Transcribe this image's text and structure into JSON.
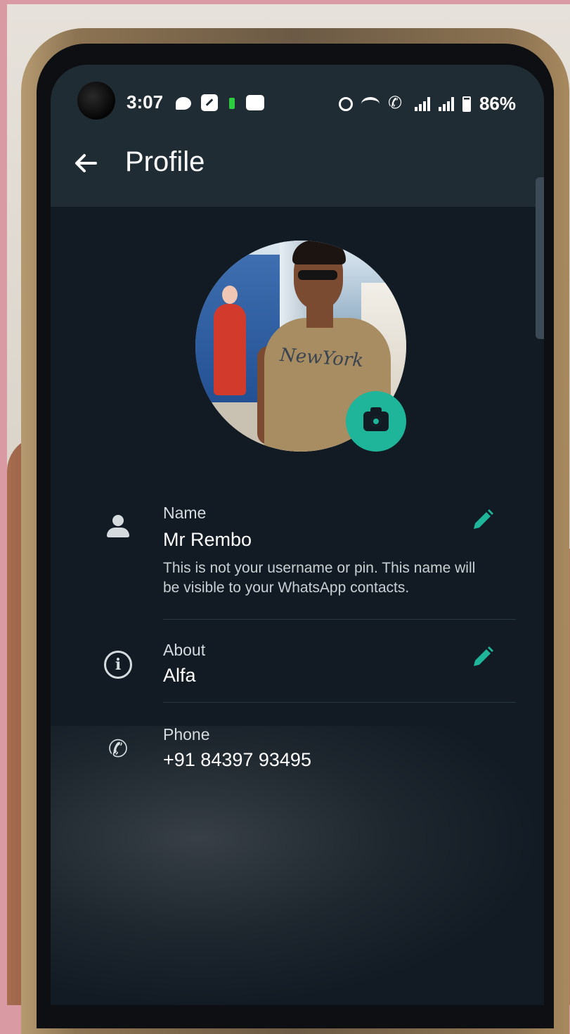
{
  "status_bar": {
    "time": "3:07",
    "battery_percent": "86%",
    "icons": [
      "chat-bubble-icon",
      "note-icon",
      "battery-mini-icon",
      "app-mini-icon",
      "alarm-icon",
      "wifi-icon",
      "call-icon",
      "signal-icon",
      "signal-icon",
      "battery-icon"
    ]
  },
  "header": {
    "title": "Profile"
  },
  "profile": {
    "photo_shirt_text": "NewYork"
  },
  "fields": {
    "name": {
      "label": "Name",
      "value": "Mr Rembo",
      "hint": "This is not your username or pin. This name will be visible to your WhatsApp contacts."
    },
    "about": {
      "label": "About",
      "value": "Alfa"
    },
    "phone": {
      "label": "Phone",
      "value": "+91 84397 93495"
    }
  },
  "colors": {
    "accent": "#1fb59a",
    "appbar": "#1f2c34",
    "background": "#121b23"
  }
}
